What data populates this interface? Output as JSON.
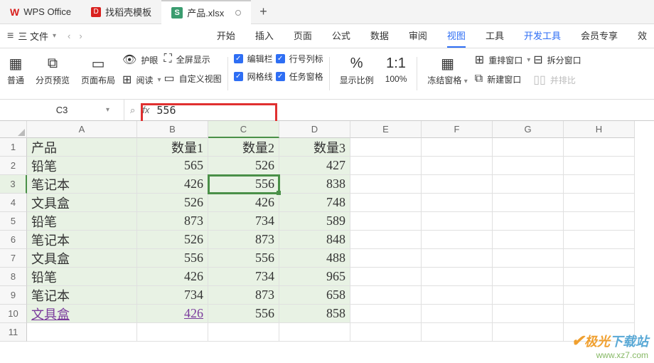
{
  "titlebar": {
    "app_name": "WPS Office",
    "tab_template": "找稻壳模板",
    "file_tab": "产品.xlsx"
  },
  "menubar": {
    "file": "三 文件",
    "items": [
      "开始",
      "插入",
      "页面",
      "公式",
      "数据",
      "审阅",
      "视图",
      "工具",
      "开发工具",
      "会员专享",
      "效"
    ]
  },
  "ribbon": {
    "normal": "普通",
    "pagebreak": "分页预览",
    "pagelayout": "页面布局",
    "eyecare": "护眼",
    "fullscreen": "全屏显示",
    "read": "阅读",
    "customview": "自定义视图",
    "editbar": "编辑栏",
    "rowcol": "行号列标",
    "gridlines": "网格线",
    "taskpane": "任务窗格",
    "zoomratio": "显示比例",
    "zoom100": "100%",
    "freeze": "冻结窗格",
    "rearrange": "重排窗口",
    "split": "拆分窗口",
    "newwin": "新建窗口",
    "sidebyside": "并排比"
  },
  "formula": {
    "namebox": "C3",
    "value": "556"
  },
  "grid": {
    "cols": [
      "A",
      "B",
      "C",
      "D",
      "E",
      "F",
      "G",
      "H"
    ],
    "headers": [
      "产品",
      "数量1",
      "数量2",
      "数量3"
    ],
    "data": [
      [
        "铅笔",
        "565",
        "526",
        "427"
      ],
      [
        "笔记本",
        "426",
        "556",
        "838"
      ],
      [
        "文具盒",
        "526",
        "426",
        "748"
      ],
      [
        "铅笔",
        "873",
        "734",
        "589"
      ],
      [
        "笔记本",
        "526",
        "873",
        "848"
      ],
      [
        "文具盒",
        "556",
        "556",
        "488"
      ],
      [
        "铅笔",
        "426",
        "734",
        "965"
      ],
      [
        "笔记本",
        "734",
        "873",
        "658"
      ],
      [
        "文具盒",
        "426",
        "556",
        "858"
      ]
    ]
  },
  "watermark": {
    "brand_pre": "极光",
    "brand_post": "下载站",
    "url": "www.xz7.com"
  },
  "chart_data": {
    "type": "table",
    "title": "产品.xlsx",
    "columns": [
      "产品",
      "数量1",
      "数量2",
      "数量3"
    ],
    "rows": [
      {
        "产品": "铅笔",
        "数量1": 565,
        "数量2": 526,
        "数量3": 427
      },
      {
        "产品": "笔记本",
        "数量1": 426,
        "数量2": 556,
        "数量3": 838
      },
      {
        "产品": "文具盒",
        "数量1": 526,
        "数量2": 426,
        "数量3": 748
      },
      {
        "产品": "铅笔",
        "数量1": 873,
        "数量2": 734,
        "数量3": 589
      },
      {
        "产品": "笔记本",
        "数量1": 526,
        "数量2": 873,
        "数量3": 848
      },
      {
        "产品": "文具盒",
        "数量1": 556,
        "数量2": 556,
        "数量3": 488
      },
      {
        "产品": "铅笔",
        "数量1": 426,
        "数量2": 734,
        "数量3": 965
      },
      {
        "产品": "笔记本",
        "数量1": 734,
        "数量2": 873,
        "数量3": 658
      },
      {
        "产品": "文具盒",
        "数量1": 426,
        "数量2": 556,
        "数量3": 858
      }
    ],
    "selected_cell": "C3",
    "selected_value": 556
  }
}
